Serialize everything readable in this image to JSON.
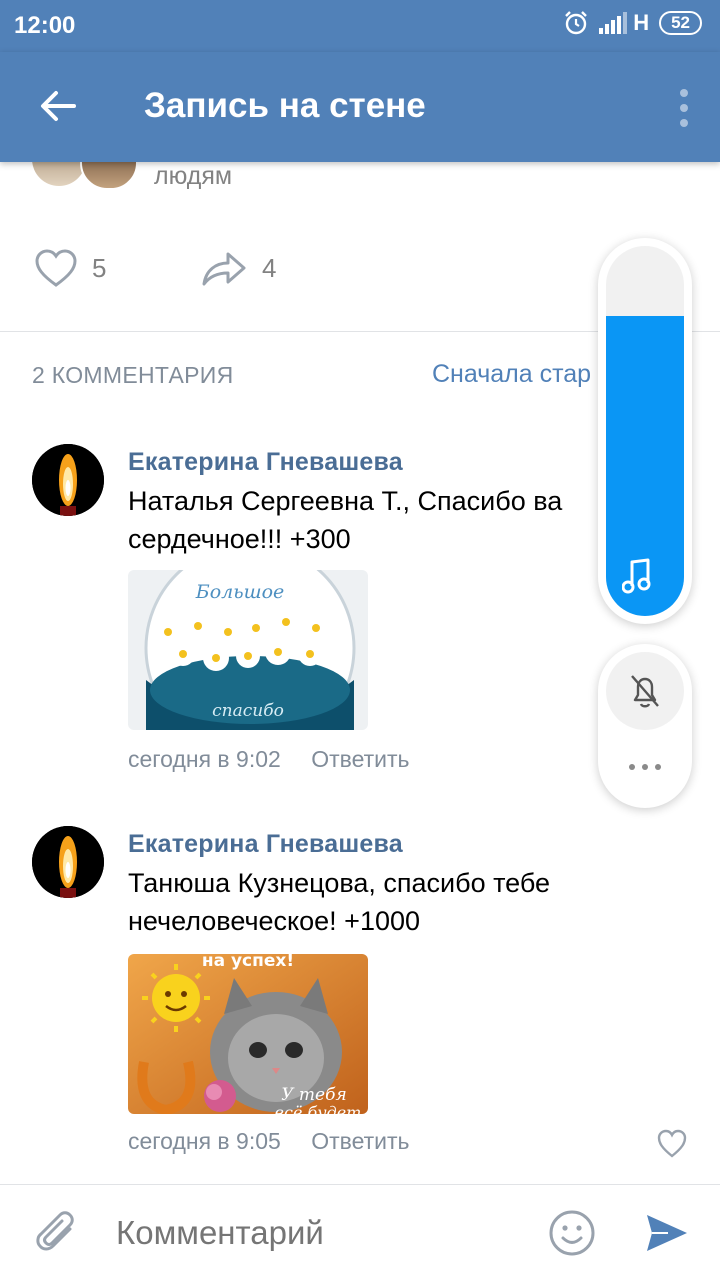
{
  "status_bar": {
    "time": "12:00",
    "network": "H",
    "battery": "52"
  },
  "app_bar": {
    "title": "Запись на стене"
  },
  "post": {
    "people_text": "людям",
    "likes_count": "5",
    "shares_count": "4"
  },
  "comments": {
    "header": "2 КОММЕНТАРИЯ",
    "sort_label": "Сначала стар",
    "items": [
      {
        "author": "Екатерина Гневашева",
        "line1": "Наталья Сергеевна Т., Спасибо ва",
        "line2": "сердечное!!! +300",
        "image_caption_top": "Большое",
        "image_caption_bottom": "спасибо",
        "time": "сегодня в 9:02",
        "reply": "Ответить"
      },
      {
        "author": "Екатерина Гневашева",
        "line1": "Танюша Кузнецова, спасибо тебе",
        "line2": "нечеловеческое! +1000",
        "image_caption_top": "на успех!",
        "image_caption_bottom_1": "У тебя",
        "image_caption_bottom_2": "всё будет",
        "time": "сегодня в 9:05",
        "reply": "Ответить"
      }
    ]
  },
  "floating_widget": {
    "volume_level": 0.81
  },
  "composer": {
    "placeholder": "Комментарий"
  },
  "colors": {
    "header": "#5181b8",
    "accent": "#0a96f5",
    "link": "#5181b8"
  }
}
